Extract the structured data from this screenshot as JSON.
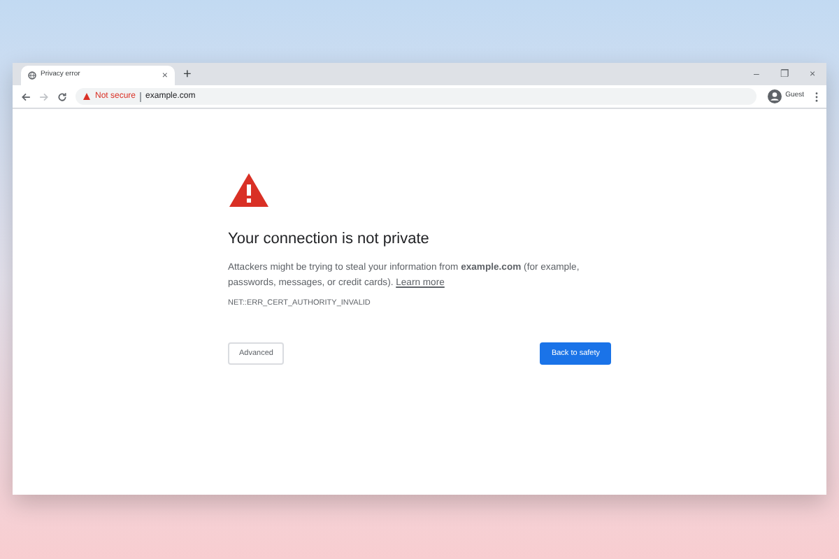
{
  "tab": {
    "title": "Privacy error",
    "close": "×",
    "new_tab": "+"
  },
  "window_controls": [
    "–",
    "❐",
    "×"
  ],
  "address_bar": {
    "security_label": "Not secure",
    "url": "example.com"
  },
  "profile": {
    "label": "Guest"
  },
  "page": {
    "title": "Your connection is not private",
    "message": "Attackers might be trying to steal your information from **example.com** (for example, passwords, messages, or credit cards).",
    "link": "Learn more",
    "error_code": "NET::ERR_CERT_AUTHORITY_INVALID",
    "buttons": [
      {
        "label": "Advanced",
        "kind": "secondary"
      },
      {
        "label": "Back to safety",
        "kind": "primary"
      }
    ]
  }
}
